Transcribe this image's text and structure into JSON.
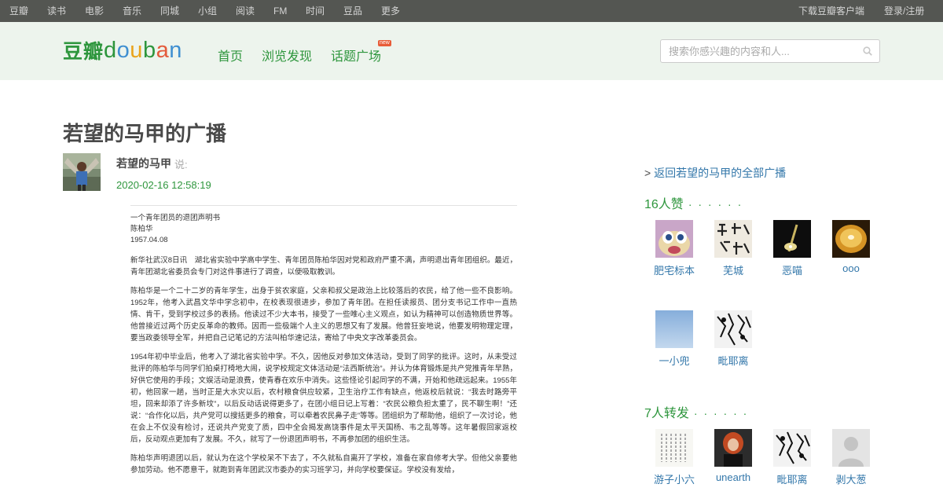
{
  "topbar": {
    "items": [
      "豆瓣",
      "读书",
      "电影",
      "音乐",
      "同城",
      "小组",
      "阅读",
      "FM",
      "时间",
      "豆品",
      "更多"
    ],
    "download": "下载豆瓣客户端",
    "login": "登录/注册"
  },
  "header": {
    "logo_cn": "豆瓣",
    "logo_en": "douban",
    "nav": [
      "首页",
      "浏览发现",
      "话题广场"
    ],
    "new_badge": "new",
    "search_placeholder": "搜索你感兴趣的内容和人..."
  },
  "main": {
    "title": "若望的马甲的广播",
    "author": "若望的马甲",
    "said": "说:",
    "timestamp": "2020-02-16 12:58:19",
    "document": {
      "heading": "一个青年团员的退团声明书",
      "author": "陈柏华",
      "date": "1957.04.08",
      "paragraphs": [
        "新华社武汉8日讯　湖北省实验中学高中学生、青年团员陈柏华因对党和政府严重不满，声明退出青年团组织。最近，青年团湖北省委员会专门对这件事进行了调查，以便吸取教训。",
        "陈柏华是一个二十二岁的青年学生，出身于贫农家庭，父亲和叔父是政治上比较落后的农民，给了他一些不良影响。1952年，他考入武昌文华中学念初中，在校表现很进步，参加了青年团。在担任读报员、团分支书记工作中一直热情、肯干，受到学校过多的表扬。他读过不少大本书，接受了一些唯心主义观点，如认为精神可以创造物质世界等。他曾接近过两个历史反革命的教师。因而一些极端个人主义的思想又有了发展。他曾狂妄地说，他要发明物理定理，要当政委领导全军，并把自己记笔记的方法叫柏华速记法，寄给了中央文字改革委员会。",
        "1954年初中毕业后，他考入了湖北省实验中学。不久，因他反对参加文体活动，受到了同学的批评。这时，从未受过批评的陈柏华与同学们拍桌打椅地大闹，说学校规定文体活动是“法西斯统治”。并认为体育锻炼是共产党推青年早熟，好供它使用的手段；文娱活动是浪费，使青春在欢乐中消失。这些怪论引起同学的不满，开始和他疏远起来。1955年初，他回家一趟，当时正是大水灾以后，农村粮食供应较紧，卫生治疗工作有缺点，他返校后就说：“我去时路旁平坦，回来却添了许多新坟”，以后反动话说得更多了，在团小组日记上写着：“农民公粮负担太重了，民不聊生啊！”还说：“合作化以后，共产党可以搜括更多的粮食，可以牵着农民鼻子走”等等。团组织为了帮助他，组织了一次讨论，他在会上不仅没有检讨，还说共产党变了质，四中全会揭发高饶事件是太平天国杨、韦之乱等等。这年暑假回家返校后，反动观点更加有了发展。不久，就写了一份退团声明书，不再参加团的组织生活。",
        "陈柏华声明退团以后，就认为在这个学校呆不下去了，不久就私自离开了学校，准备在家自修考大学。但他父亲要他参加劳动。他不愿意干，就跑到青年团武汉市委办的实习班学习，并向学校要保证。学校没有发给，"
      ]
    }
  },
  "aside": {
    "back_link": "返回若望的马甲的全部广播",
    "likes_title": "16人赞",
    "likes_users": [
      "肥宅标本",
      "芜城",
      "恶喵",
      "ooo",
      "一小兜",
      "毗耶离"
    ],
    "reshares_title": "7人转发",
    "reshares_users": [
      "游子小六",
      "unearth",
      "毗耶离",
      "剥大葱"
    ],
    "dots": "· · · · · ·"
  },
  "colors": {
    "topbar_bg": "#545652",
    "header_bg": "#edf4ed",
    "brand_green": "#2e963d",
    "link_blue": "#3377aa"
  }
}
